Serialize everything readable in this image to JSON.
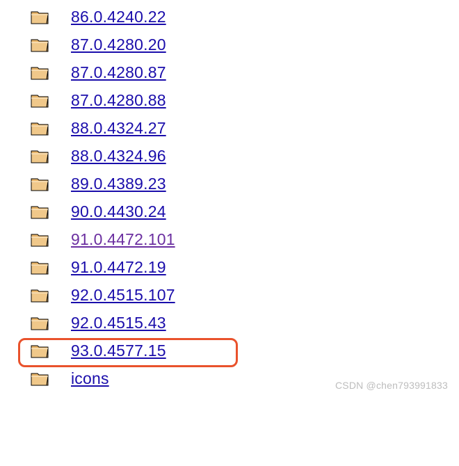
{
  "items": [
    {
      "name": "86.0.4240.22",
      "visited": false,
      "highlighted": false
    },
    {
      "name": "87.0.4280.20",
      "visited": false,
      "highlighted": false
    },
    {
      "name": "87.0.4280.87",
      "visited": false,
      "highlighted": false
    },
    {
      "name": "87.0.4280.88",
      "visited": false,
      "highlighted": false
    },
    {
      "name": "88.0.4324.27",
      "visited": false,
      "highlighted": false
    },
    {
      "name": "88.0.4324.96",
      "visited": false,
      "highlighted": false
    },
    {
      "name": "89.0.4389.23",
      "visited": false,
      "highlighted": false
    },
    {
      "name": "90.0.4430.24",
      "visited": false,
      "highlighted": false
    },
    {
      "name": "91.0.4472.101",
      "visited": true,
      "highlighted": false
    },
    {
      "name": "91.0.4472.19",
      "visited": false,
      "highlighted": false
    },
    {
      "name": "92.0.4515.107",
      "visited": false,
      "highlighted": false
    },
    {
      "name": "92.0.4515.43",
      "visited": false,
      "highlighted": false
    },
    {
      "name": "93.0.4577.15",
      "visited": false,
      "highlighted": true
    },
    {
      "name": "icons",
      "visited": false,
      "highlighted": false
    }
  ],
  "watermark": "CSDN @chen793991833"
}
